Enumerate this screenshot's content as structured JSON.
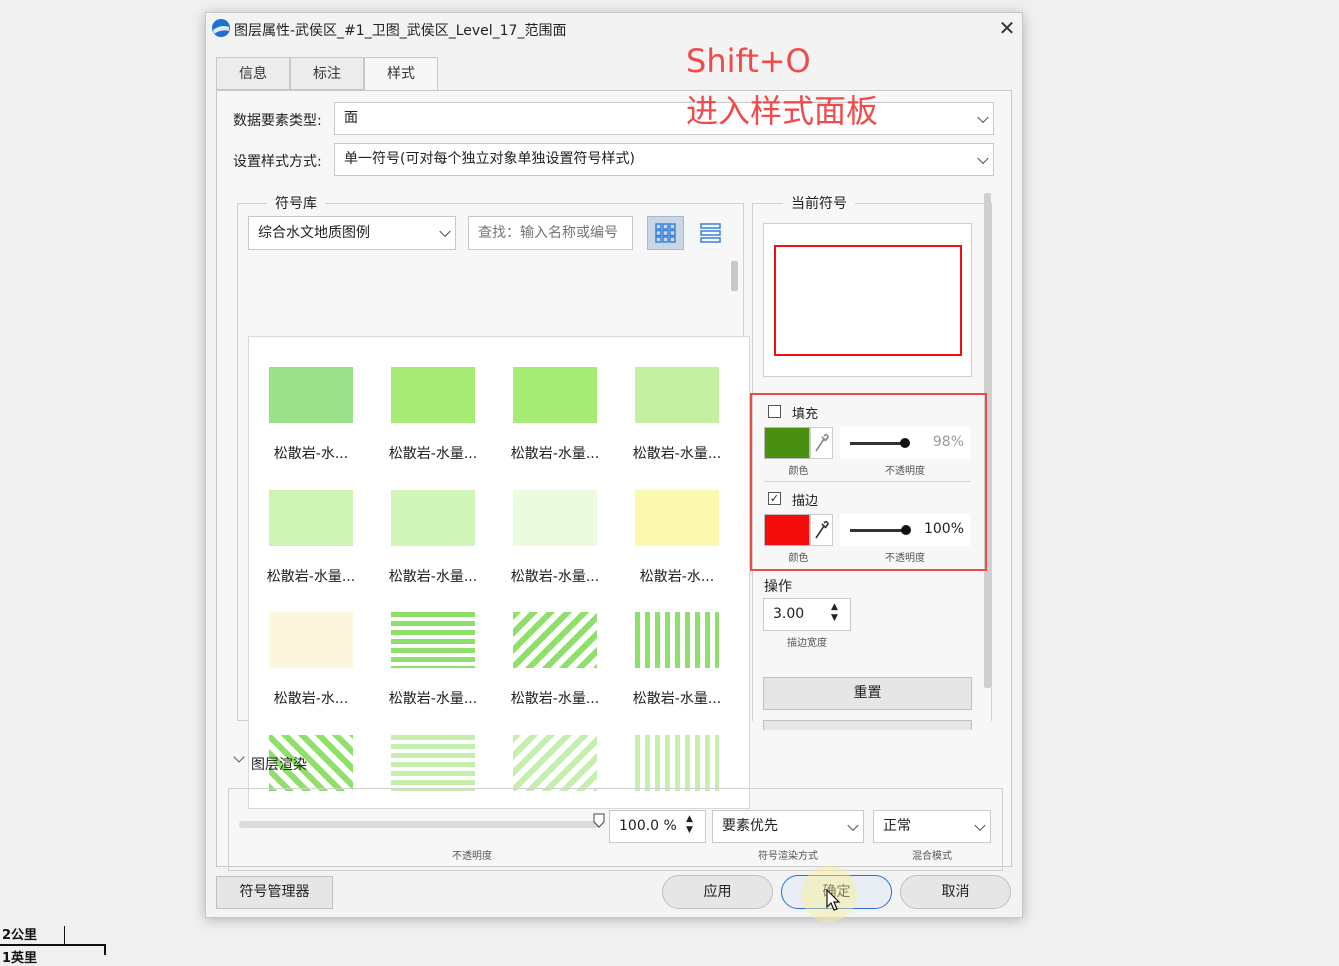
{
  "window": {
    "title": "图层属性-武侯区_#1_卫图_武侯区_Level_17_范围面",
    "close_icon": "close-icon"
  },
  "tabs": [
    {
      "label": "信息",
      "active": false
    },
    {
      "label": "标注",
      "active": false
    },
    {
      "label": "样式",
      "active": true
    }
  ],
  "style_panel": {
    "data_type_label": "数据要素类型:",
    "data_type_value": "面",
    "style_mode_label": "设置样式方式:",
    "style_mode_value": "单一符号(可对每个独立对象单独设置符号样式)"
  },
  "symbol_library": {
    "title": "符号库",
    "library_value": "综合水文地质图例",
    "search_placeholder": "查找：输入名称或编号",
    "view_grid_icon": "grid-view-icon",
    "view_list_icon": "list-view-icon",
    "items": [
      {
        "label": "松散岩-水...",
        "color": "#9de08a",
        "pattern": "solid"
      },
      {
        "label": "松散岩-水量...",
        "color": "#a8eb74",
        "pattern": "solid"
      },
      {
        "label": "松散岩-水量...",
        "color": "#a6eb76",
        "pattern": "solid"
      },
      {
        "label": "松散岩-水量...",
        "color": "#c4f0a4",
        "pattern": "solid"
      },
      {
        "label": "松散岩-水量...",
        "color": "#cff3b5",
        "pattern": "solid"
      },
      {
        "label": "松散岩-水量...",
        "color": "#d2f5b9",
        "pattern": "solid"
      },
      {
        "label": "松散岩-水量...",
        "color": "#eafbe0",
        "pattern": "dots"
      },
      {
        "label": "松散岩-水...",
        "color": "#fbf9ad",
        "pattern": "solid"
      },
      {
        "label": "松散岩-水...",
        "color": "#fdf6dc",
        "pattern": "dots"
      },
      {
        "label": "松散岩-水量...",
        "color": "#8fe06a",
        "pattern": "hlines"
      },
      {
        "label": "松散岩-水量...",
        "color": "#8fe06a",
        "pattern": "diag"
      },
      {
        "label": "松散岩-水量...",
        "color": "#8fe06a",
        "pattern": "vlines"
      },
      {
        "label": "",
        "color": "#8fe06a",
        "pattern": "diag-rev"
      },
      {
        "label": "",
        "color": "#c6efae",
        "pattern": "hlines"
      },
      {
        "label": "",
        "color": "#c6efae",
        "pattern": "diag"
      },
      {
        "label": "",
        "color": "#c6efae",
        "pattern": "vlines"
      }
    ]
  },
  "current_symbol": {
    "title": "当前符号",
    "fill": {
      "label": "填充",
      "checked": false,
      "color": "#4a8f0f",
      "opacity_text": "98%",
      "opacity": 0.98,
      "color_caption": "颜色",
      "opacity_caption": "不透明度"
    },
    "stroke": {
      "label": "描边",
      "checked": true,
      "color": "#f40c0c",
      "opacity_text": "100%",
      "opacity": 1.0,
      "color_caption": "颜色",
      "opacity_caption": "不透明度"
    },
    "operation_label": "操作",
    "stroke_width_value": "3.00",
    "stroke_width_caption": "描边宽度",
    "reset_label": "重置"
  },
  "layer_render": {
    "section_label": "图层渲染",
    "opacity_value": "100.0 %",
    "opacity_caption": "不透明度",
    "opacity": 1.0,
    "render_mode_value": "要素优先",
    "render_mode_caption": "符号渲染方式",
    "blend_value": "正常",
    "blend_caption": "混合模式"
  },
  "footer": {
    "symbol_manager_label": "符号管理器",
    "apply_label": "应用",
    "ok_label": "确定",
    "cancel_label": "取消"
  },
  "annotation": {
    "line1": "Shift+O",
    "line2": "进入样式面板",
    "color": "#f04a4a"
  },
  "scale_bar": {
    "label1": "2公里",
    "label2": "1英里"
  }
}
